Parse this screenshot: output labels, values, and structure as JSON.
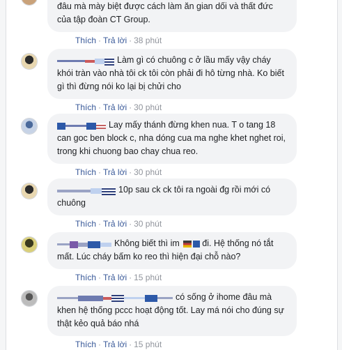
{
  "comments": [
    {
      "text": "đâu mà mày biệt được cách làm ăn gian dối và thất đức của tập đoàn CT Group.",
      "actions": {
        "like": "Thích",
        "reply": "Trả lời",
        "time": "38 phút"
      }
    },
    {
      "text": "Làm gì có chuông c ở lầu mấy vậy cháy khói tràn vào nhà tôi ck tôi còn phải đi hô từng nhà. Ko biết gì thì đừng nói ko lại bị chửi cho",
      "actions": {
        "like": "Thích",
        "reply": "Trả lời",
        "time": "30 phút"
      }
    },
    {
      "text": "Lay mấy thánh đừng khen nua. T o tang 18 can goc ben block c, nha dóng cua ma nghe khet nghet roi, trong khi chuong bao chay chua reo.",
      "actions": {
        "like": "Thích",
        "reply": "Trả lời",
        "time": "30 phút"
      }
    },
    {
      "text": "10p sau ck ck tôi ra ngoài đg rồi mới có chuông",
      "actions": {
        "like": "Thích",
        "reply": "Trả lời",
        "time": "30 phút"
      }
    },
    {
      "text_a": "Không biết thì im",
      "text_b": "đi. Hệ thống nó tắt mất. Lúc cháy bấm ko reo thì hiện đại chỗ nào?",
      "actions": {
        "like": "Thích",
        "reply": "Trả lời",
        "time": "15 phút"
      }
    },
    {
      "text": "có sống ở ihome đâu mà khen hệ thống pccc hoạt động tốt. Lay má nói cho đúng sự thật kẻo quả báo nhá",
      "actions": {
        "like": "Thích",
        "reply": "Trả lời",
        "time": "15 phút"
      }
    }
  ]
}
